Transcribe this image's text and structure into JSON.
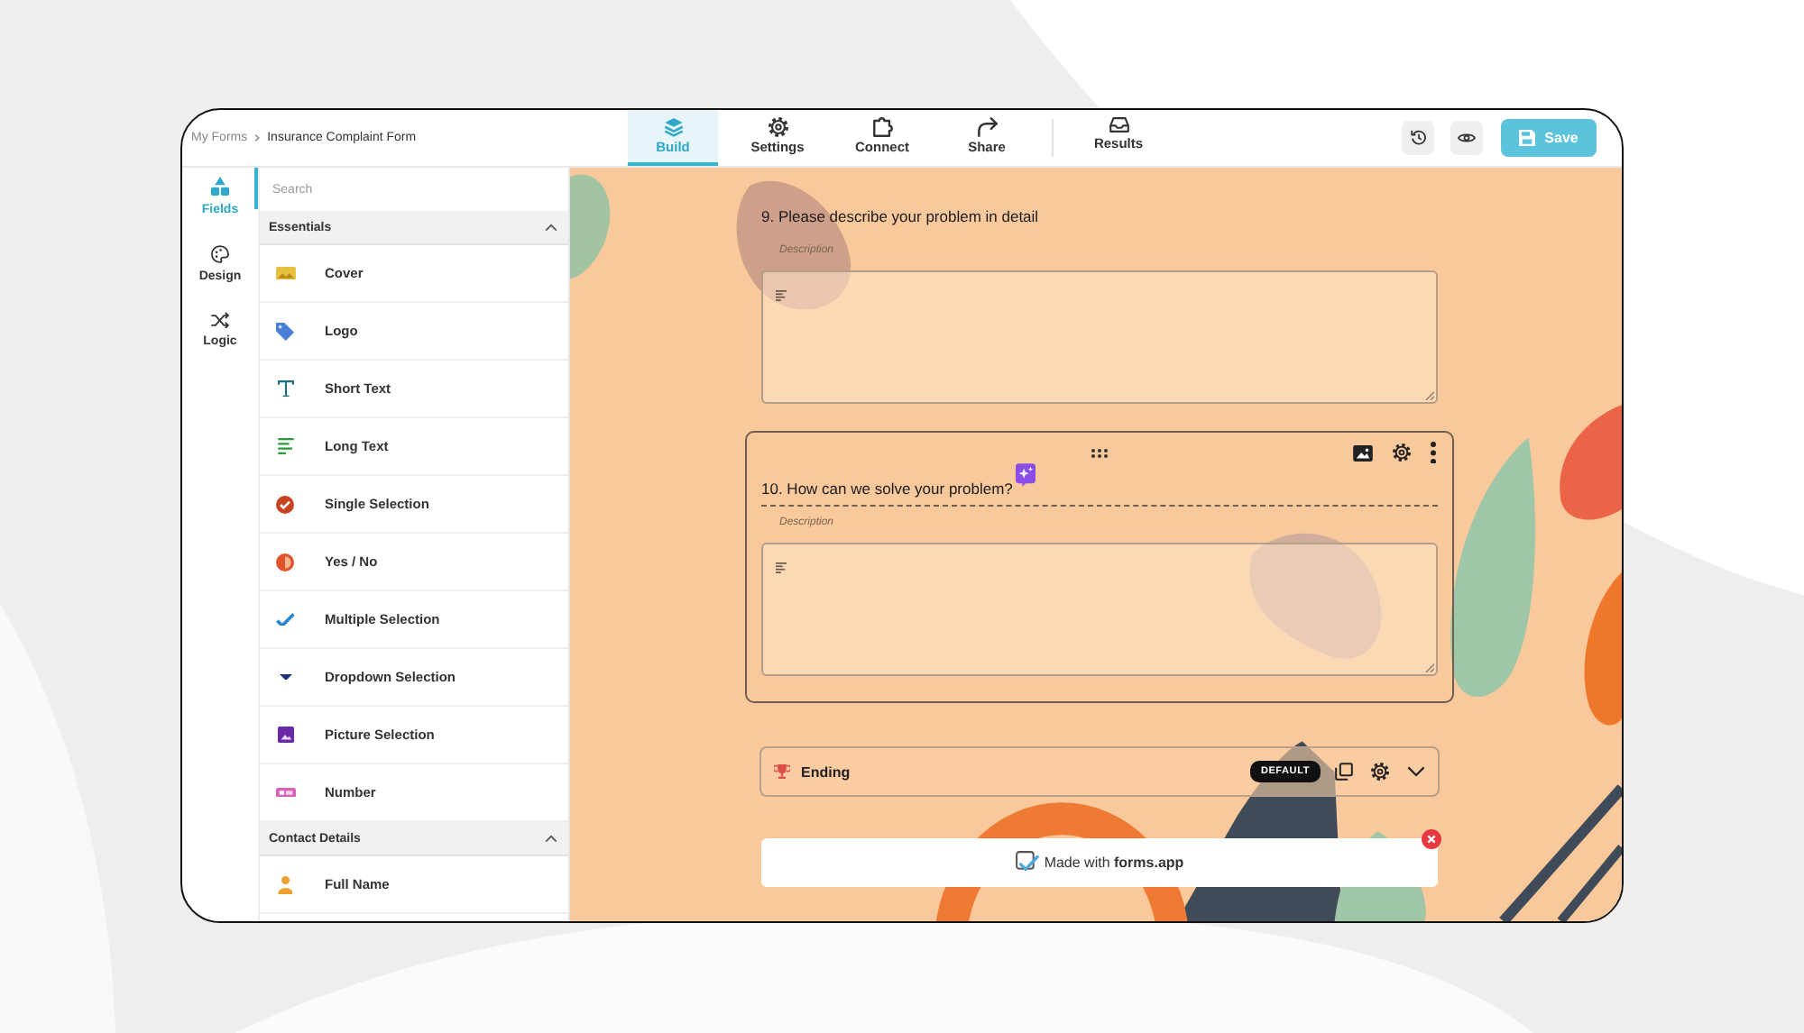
{
  "breadcrumb": {
    "parent": "My Forms",
    "current": "Insurance Complaint Form"
  },
  "tabs": [
    {
      "label": "Build",
      "selected": true
    },
    {
      "label": "Settings",
      "selected": false
    },
    {
      "label": "Connect",
      "selected": false
    },
    {
      "label": "Share",
      "selected": false
    },
    {
      "label": "Results",
      "selected": false
    }
  ],
  "save_button": "Save",
  "rail": [
    {
      "label": "Fields",
      "selected": true
    },
    {
      "label": "Design",
      "selected": false
    },
    {
      "label": "Logic",
      "selected": false
    }
  ],
  "search": {
    "placeholder": "Search"
  },
  "sections": [
    {
      "title": "Essentials",
      "expanded": true,
      "items": [
        "Cover",
        "Logo",
        "Short Text",
        "Long Text",
        "Single Selection",
        "Yes / No",
        "Multiple Selection",
        "Dropdown Selection",
        "Picture Selection",
        "Number"
      ]
    },
    {
      "title": "Contact Details",
      "expanded": true,
      "items": [
        "Full Name"
      ]
    }
  ],
  "questions": [
    {
      "title": "9. Please describe your problem in detail",
      "description": "Description",
      "selected": false
    },
    {
      "title": "10. How can we solve your problem?",
      "description": "Description",
      "selected": true
    }
  ],
  "ending": {
    "label": "Ending",
    "badge": "DEFAULT"
  },
  "branding": "Made with **forms.app**"
}
